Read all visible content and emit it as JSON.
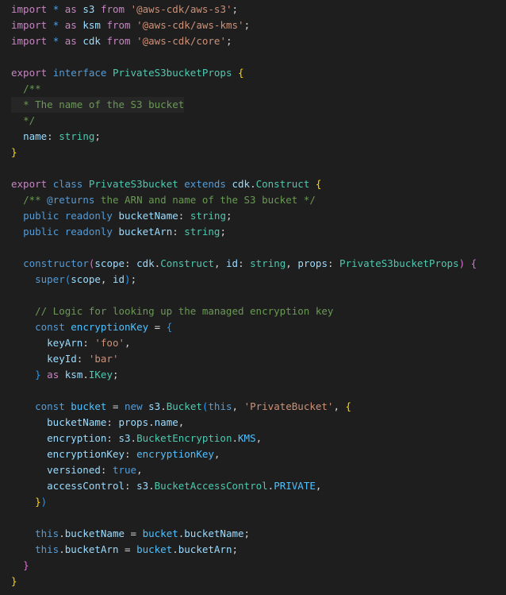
{
  "editor": {
    "lines": [
      [
        [
          "import",
          "kw"
        ],
        [
          " ",
          "pun"
        ],
        [
          "*",
          "st"
        ],
        [
          " ",
          "pun"
        ],
        [
          "as",
          "kw"
        ],
        [
          " ",
          "pun"
        ],
        [
          "s3",
          "ns"
        ],
        [
          " ",
          "pun"
        ],
        [
          "from",
          "kw"
        ],
        [
          " ",
          "pun"
        ],
        [
          "'@aws-cdk/aws-s3'",
          "str"
        ],
        [
          ";",
          "pun"
        ]
      ],
      [
        [
          "import",
          "kw"
        ],
        [
          " ",
          "pun"
        ],
        [
          "*",
          "st"
        ],
        [
          " ",
          "pun"
        ],
        [
          "as",
          "kw"
        ],
        [
          " ",
          "pun"
        ],
        [
          "ksm",
          "ns"
        ],
        [
          " ",
          "pun"
        ],
        [
          "from",
          "kw"
        ],
        [
          " ",
          "pun"
        ],
        [
          "'@aws-cdk/aws-kms'",
          "str"
        ],
        [
          ";",
          "pun"
        ]
      ],
      [
        [
          "import",
          "kw"
        ],
        [
          " ",
          "pun"
        ],
        [
          "*",
          "st"
        ],
        [
          " ",
          "pun"
        ],
        [
          "as",
          "kw"
        ],
        [
          " ",
          "pun"
        ],
        [
          "cdk",
          "ns"
        ],
        [
          " ",
          "pun"
        ],
        [
          "from",
          "kw"
        ],
        [
          " ",
          "pun"
        ],
        [
          "'@aws-cdk/core'",
          "str"
        ],
        [
          ";",
          "pun"
        ]
      ],
      [],
      [
        [
          "export",
          "kw"
        ],
        [
          " ",
          "pun"
        ],
        [
          "interface",
          "st"
        ],
        [
          " ",
          "pun"
        ],
        [
          "PrivateS3bucketProps",
          "type"
        ],
        [
          " ",
          "pun"
        ],
        [
          "{",
          "br"
        ]
      ],
      [
        [
          "  ",
          "pun"
        ],
        [
          "/**",
          "com"
        ]
      ],
      [
        [
          "  ",
          "pun"
        ],
        [
          "* The name of the S3 bucket",
          "com"
        ]
      ],
      [
        [
          "  ",
          "pun"
        ],
        [
          "*/",
          "com"
        ]
      ],
      [
        [
          "  ",
          "pun"
        ],
        [
          "name",
          "prop"
        ],
        [
          ": ",
          "pun"
        ],
        [
          "string",
          "type"
        ],
        [
          ";",
          "pun"
        ]
      ],
      [
        [
          "}",
          "br"
        ]
      ],
      [],
      [
        [
          "export",
          "kw"
        ],
        [
          " ",
          "pun"
        ],
        [
          "class",
          "st"
        ],
        [
          " ",
          "pun"
        ],
        [
          "PrivateS3bucket",
          "type"
        ],
        [
          " ",
          "pun"
        ],
        [
          "extends",
          "st"
        ],
        [
          " ",
          "pun"
        ],
        [
          "cdk",
          "ns"
        ],
        [
          ".",
          "pun"
        ],
        [
          "Construct",
          "type"
        ],
        [
          " ",
          "pun"
        ],
        [
          "{",
          "br"
        ]
      ],
      [
        [
          "  ",
          "pun"
        ],
        [
          "/** ",
          "com"
        ],
        [
          "@returns",
          "tag"
        ],
        [
          " the ARN and name of the S3 bucket */",
          "com"
        ]
      ],
      [
        [
          "  ",
          "pun"
        ],
        [
          "public",
          "st"
        ],
        [
          " ",
          "pun"
        ],
        [
          "readonly",
          "st"
        ],
        [
          " ",
          "pun"
        ],
        [
          "bucketName",
          "prop"
        ],
        [
          ": ",
          "pun"
        ],
        [
          "string",
          "type"
        ],
        [
          ";",
          "pun"
        ]
      ],
      [
        [
          "  ",
          "pun"
        ],
        [
          "public",
          "st"
        ],
        [
          " ",
          "pun"
        ],
        [
          "readonly",
          "st"
        ],
        [
          " ",
          "pun"
        ],
        [
          "bucketArn",
          "prop"
        ],
        [
          ": ",
          "pun"
        ],
        [
          "string",
          "type"
        ],
        [
          ";",
          "pun"
        ]
      ],
      [],
      [
        [
          "  ",
          "pun"
        ],
        [
          "constructor",
          "st"
        ],
        [
          "(",
          "br2"
        ],
        [
          "scope",
          "prop"
        ],
        [
          ": ",
          "pun"
        ],
        [
          "cdk",
          "ns"
        ],
        [
          ".",
          "pun"
        ],
        [
          "Construct",
          "type"
        ],
        [
          ", ",
          "pun"
        ],
        [
          "id",
          "prop"
        ],
        [
          ": ",
          "pun"
        ],
        [
          "string",
          "type"
        ],
        [
          ", ",
          "pun"
        ],
        [
          "props",
          "prop"
        ],
        [
          ": ",
          "pun"
        ],
        [
          "PrivateS3bucketProps",
          "type"
        ],
        [
          ")",
          "br2"
        ],
        [
          " ",
          "pun"
        ],
        [
          "{",
          "br2"
        ]
      ],
      [
        [
          "    ",
          "pun"
        ],
        [
          "super",
          "st"
        ],
        [
          "(",
          "br3"
        ],
        [
          "scope",
          "prop"
        ],
        [
          ", ",
          "pun"
        ],
        [
          "id",
          "prop"
        ],
        [
          ")",
          "br3"
        ],
        [
          ";",
          "pun"
        ]
      ],
      [],
      [
        [
          "    ",
          "pun"
        ],
        [
          "// Logic for looking up the managed encryption key",
          "com"
        ]
      ],
      [
        [
          "    ",
          "pun"
        ],
        [
          "const",
          "st"
        ],
        [
          " ",
          "pun"
        ],
        [
          "encryptionKey",
          "const"
        ],
        [
          " = ",
          "pun"
        ],
        [
          "{",
          "br3"
        ]
      ],
      [
        [
          "      ",
          "pun"
        ],
        [
          "keyArn",
          "prop"
        ],
        [
          ": ",
          "pun"
        ],
        [
          "'foo'",
          "str"
        ],
        [
          ",",
          "pun"
        ]
      ],
      [
        [
          "      ",
          "pun"
        ],
        [
          "keyId",
          "prop"
        ],
        [
          ": ",
          "pun"
        ],
        [
          "'bar'",
          "str"
        ]
      ],
      [
        [
          "    ",
          "pun"
        ],
        [
          "}",
          "br3"
        ],
        [
          " ",
          "pun"
        ],
        [
          "as",
          "kw"
        ],
        [
          " ",
          "pun"
        ],
        [
          "ksm",
          "ns"
        ],
        [
          ".",
          "pun"
        ],
        [
          "IKey",
          "type"
        ],
        [
          ";",
          "pun"
        ]
      ],
      [],
      [
        [
          "    ",
          "pun"
        ],
        [
          "const",
          "st"
        ],
        [
          " ",
          "pun"
        ],
        [
          "bucket",
          "const"
        ],
        [
          " = ",
          "pun"
        ],
        [
          "new",
          "st"
        ],
        [
          " ",
          "pun"
        ],
        [
          "s3",
          "ns"
        ],
        [
          ".",
          "pun"
        ],
        [
          "Bucket",
          "type"
        ],
        [
          "(",
          "br3"
        ],
        [
          "this",
          "st"
        ],
        [
          ", ",
          "pun"
        ],
        [
          "'PrivateBucket'",
          "str"
        ],
        [
          ", ",
          "pun"
        ],
        [
          "{",
          "br"
        ]
      ],
      [
        [
          "      ",
          "pun"
        ],
        [
          "bucketName",
          "prop"
        ],
        [
          ": ",
          "pun"
        ],
        [
          "props",
          "prop"
        ],
        [
          ".",
          "pun"
        ],
        [
          "name",
          "prop"
        ],
        [
          ",",
          "pun"
        ]
      ],
      [
        [
          "      ",
          "pun"
        ],
        [
          "encryption",
          "prop"
        ],
        [
          ": ",
          "pun"
        ],
        [
          "s3",
          "ns"
        ],
        [
          ".",
          "pun"
        ],
        [
          "BucketEncryption",
          "type"
        ],
        [
          ".",
          "pun"
        ],
        [
          "KMS",
          "const"
        ],
        [
          ",",
          "pun"
        ]
      ],
      [
        [
          "      ",
          "pun"
        ],
        [
          "encryptionKey",
          "prop"
        ],
        [
          ": ",
          "pun"
        ],
        [
          "encryptionKey",
          "const"
        ],
        [
          ",",
          "pun"
        ]
      ],
      [
        [
          "      ",
          "pun"
        ],
        [
          "versioned",
          "prop"
        ],
        [
          ": ",
          "pun"
        ],
        [
          "true",
          "st"
        ],
        [
          ",",
          "pun"
        ]
      ],
      [
        [
          "      ",
          "pun"
        ],
        [
          "accessControl",
          "prop"
        ],
        [
          ": ",
          "pun"
        ],
        [
          "s3",
          "ns"
        ],
        [
          ".",
          "pun"
        ],
        [
          "BucketAccessControl",
          "type"
        ],
        [
          ".",
          "pun"
        ],
        [
          "PRIVATE",
          "const"
        ],
        [
          ",",
          "pun"
        ]
      ],
      [
        [
          "    ",
          "pun"
        ],
        [
          "}",
          "br"
        ],
        [
          ")",
          "br3"
        ]
      ],
      [],
      [
        [
          "    ",
          "pun"
        ],
        [
          "this",
          "st"
        ],
        [
          ".",
          "pun"
        ],
        [
          "bucketName",
          "prop"
        ],
        [
          " = ",
          "pun"
        ],
        [
          "bucket",
          "const"
        ],
        [
          ".",
          "pun"
        ],
        [
          "bucketName",
          "prop"
        ],
        [
          ";",
          "pun"
        ]
      ],
      [
        [
          "    ",
          "pun"
        ],
        [
          "this",
          "st"
        ],
        [
          ".",
          "pun"
        ],
        [
          "bucketArn",
          "prop"
        ],
        [
          " = ",
          "pun"
        ],
        [
          "bucket",
          "const"
        ],
        [
          ".",
          "pun"
        ],
        [
          "bucketArn",
          "prop"
        ],
        [
          ";",
          "pun"
        ]
      ],
      [
        [
          "  ",
          "pun"
        ],
        [
          "}",
          "br2"
        ]
      ],
      [
        [
          "}",
          "br"
        ]
      ]
    ]
  }
}
